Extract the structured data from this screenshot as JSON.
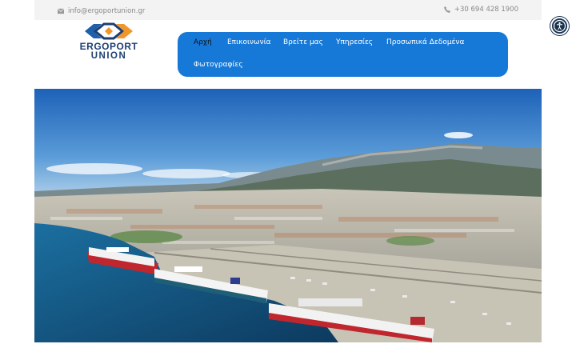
{
  "topbar": {
    "email": "info@ergoportunion.gr",
    "phone": "+30 694 428 1900"
  },
  "logo": {
    "line1": "ERGOPORT",
    "line2": "UNION",
    "colors": {
      "navy": "#1c3f73",
      "orange": "#f0962b",
      "blue": "#1f5ea8"
    }
  },
  "nav": {
    "items": [
      {
        "label": "Αρχή",
        "active": true
      },
      {
        "label": "Επικοινωνία",
        "active": false
      },
      {
        "label": "Βρείτε μας",
        "active": false
      },
      {
        "label": "Υπηρεσίες",
        "active": false
      },
      {
        "label": "Προσωπικά Δεδομένα",
        "active": false
      },
      {
        "label": "Φωτογραφίες",
        "active": false
      }
    ],
    "background": "#1679d8"
  },
  "hero": {
    "description_icon": "aerial-port-photo"
  },
  "accessibility": {
    "icon": "accessibility-icon"
  }
}
